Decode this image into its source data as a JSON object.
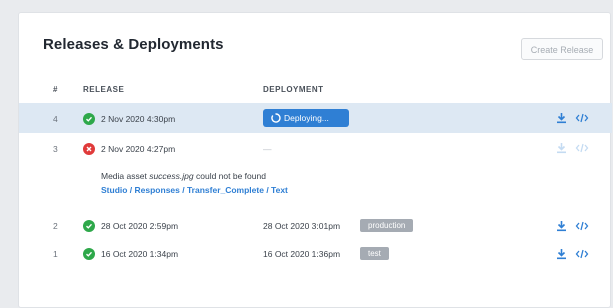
{
  "header": {
    "title": "Releases & Deployments",
    "create_label": "Create Release"
  },
  "columns": {
    "number": "#",
    "release": "RELEASE",
    "deployment": "DEPLOYMENT"
  },
  "rows": [
    {
      "number": "4",
      "status": "success",
      "release_date": "2 Nov 2020 4:30pm",
      "deploy_state": "Deploying...",
      "active": true
    },
    {
      "number": "3",
      "status": "failed",
      "release_date": "2 Nov 2020 4:27pm",
      "deploy_placeholder": "—",
      "error": {
        "prefix": "Media asset ",
        "file": "success.jpg",
        "suffix": " could not be found",
        "path": "Studio / Responses / Transfer_Complete / Text"
      }
    },
    {
      "number": "2",
      "status": "success",
      "release_date": "28 Oct 2020 2:59pm",
      "deploy_date": "28 Oct 2020 3:01pm",
      "environment": "production"
    },
    {
      "number": "1",
      "status": "success",
      "release_date": "16 Oct 2020 1:34pm",
      "deploy_date": "16 Oct 2020 1:36pm",
      "environment": "test"
    }
  ],
  "icons": {
    "download": "download-icon",
    "code": "code-icon",
    "success": "check-circle-icon",
    "failed": "x-circle-icon"
  },
  "colors": {
    "accent": "#2f7fd4",
    "success": "#2ea84a",
    "error": "#e03a3a",
    "active_row": "#dde8f3",
    "badge": "#a5abb3"
  }
}
